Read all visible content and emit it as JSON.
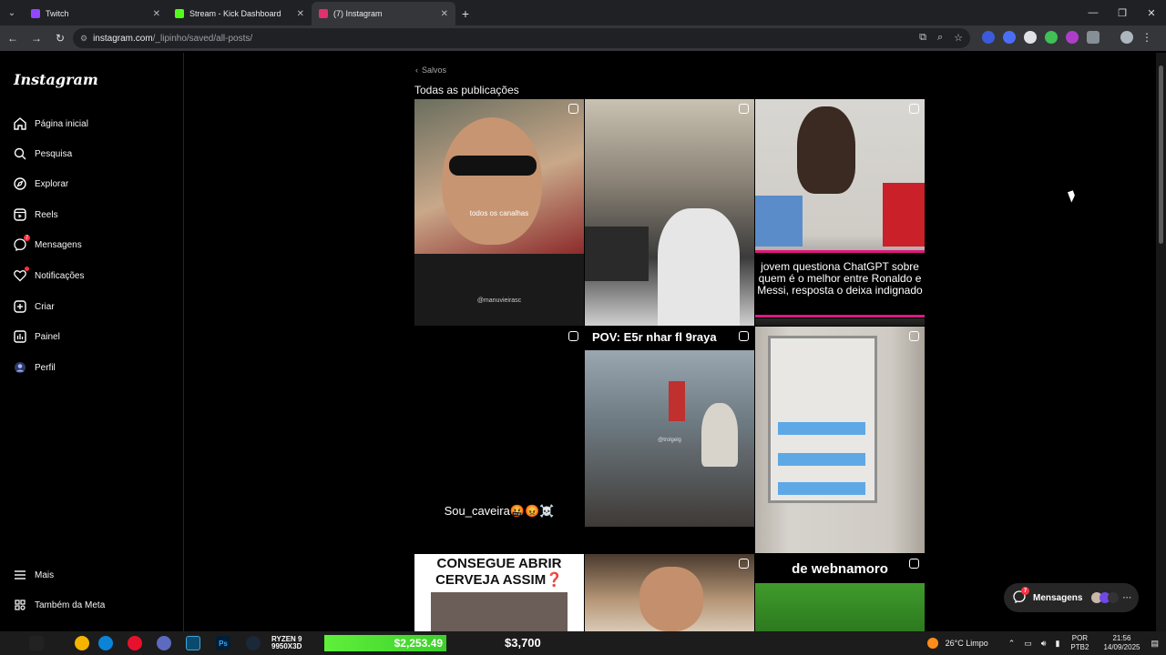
{
  "browser": {
    "tabs": [
      {
        "title": "Twitch",
        "color": "#9146ff"
      },
      {
        "title": "Stream - Kick Dashboard",
        "color": "#53fc18"
      },
      {
        "title": "(7) Instagram",
        "color": "#e1306c"
      }
    ],
    "url_host": "instagram.com",
    "url_path": "/_lipinho/saved/all-posts/"
  },
  "sidebar": {
    "logo": "Instagram",
    "items": [
      {
        "label": "Página inicial",
        "icon": "home-icon"
      },
      {
        "label": "Pesquisa",
        "icon": "search-icon"
      },
      {
        "label": "Explorar",
        "icon": "compass-icon"
      },
      {
        "label": "Reels",
        "icon": "reels-icon"
      },
      {
        "label": "Mensagens",
        "icon": "messenger-icon",
        "badge": "7"
      },
      {
        "label": "Notificações",
        "icon": "heart-icon"
      },
      {
        "label": "Criar",
        "icon": "plus-square-icon"
      },
      {
        "label": "Painel",
        "icon": "chart-icon"
      },
      {
        "label": "Perfil",
        "icon": "avatar-icon"
      }
    ],
    "bottom_items": [
      {
        "label": "Mais",
        "icon": "menu-icon"
      },
      {
        "label": "Também da Meta",
        "icon": "meta-icon"
      }
    ]
  },
  "main": {
    "back_label": "Salvos",
    "heading": "Todas as publicações",
    "posts": [
      {
        "overlay": "todos os canalhas",
        "watermark": "@manuvieirasc"
      },
      {
        "overlay": ""
      },
      {
        "overlay": "jovem questiona ChatGPT sobre quem é o melhor entre Ronaldo e Messi, resposta o deixa indignado"
      },
      {
        "overlay": "Sou_caveira🤬😡☠️"
      },
      {
        "overlay": "POV: E5r nhar fl 9raya",
        "watermark": "@trolgelg"
      },
      {
        "overlay": ""
      },
      {
        "overlay": "CONSEGUE ABRIR CERVEJA ASSIM❓"
      },
      {
        "overlay": ""
      },
      {
        "overlay": "de webnamoro"
      }
    ]
  },
  "messages_pill": {
    "label": "Mensagens",
    "badge": "7"
  },
  "taskbar": {
    "cpu_label": "RYZEN 9 9950X3D",
    "price1": "$2,253.49",
    "price2": "$3,700",
    "weather": "26°C  Limpo",
    "lang": "POR",
    "lang2": "PTB2",
    "time": "21:56",
    "date": "14/09/2025"
  }
}
